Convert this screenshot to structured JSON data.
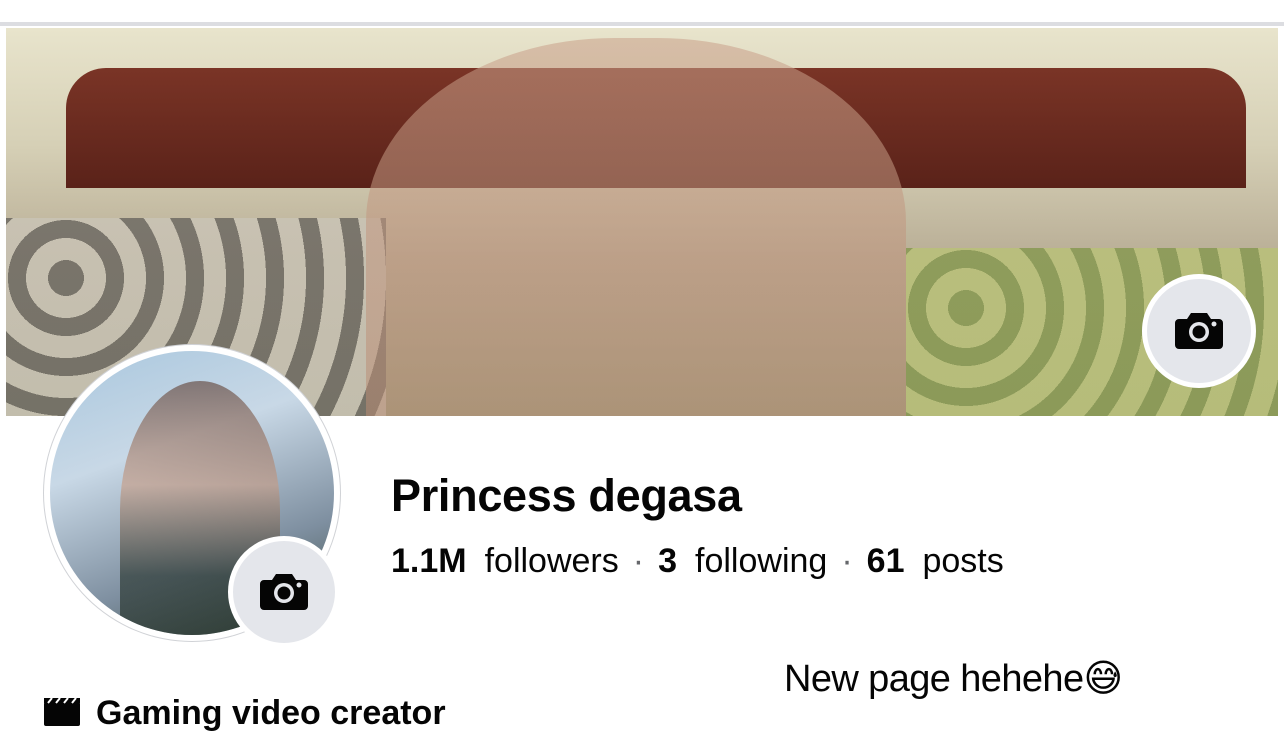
{
  "profile": {
    "name": "Princess degasa",
    "followers_count": "1.1M",
    "followers_label": "followers",
    "following_count": "3",
    "following_label": "following",
    "posts_count": "61",
    "posts_label": "posts",
    "separator": "·",
    "category_label": "Gaming video creator",
    "category_icon": "clapperboard-icon"
  },
  "caption": {
    "text": "New page hehehe😅"
  },
  "buttons": {
    "cover_camera_icon": "camera-icon",
    "avatar_camera_icon": "camera-icon"
  }
}
